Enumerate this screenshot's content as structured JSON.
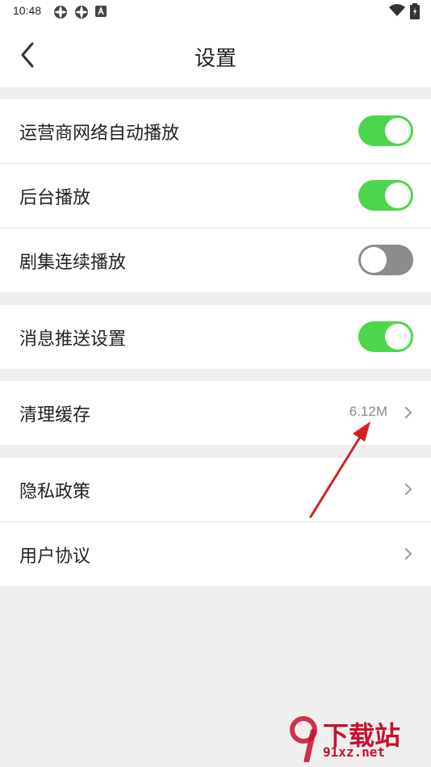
{
  "status_bar": {
    "time": "10:48",
    "icons": [
      "app-notification-icon",
      "app-notification-icon",
      "font-badge-icon",
      "wifi-icon",
      "battery-icon"
    ]
  },
  "header": {
    "title": "设置",
    "back_icon": "chevron-left-icon"
  },
  "groups": [
    {
      "items": [
        {
          "label": "运营商网络自动播放",
          "toggle": "on"
        },
        {
          "label": "后台播放",
          "toggle": "on"
        },
        {
          "label": "剧集连续播放",
          "toggle": "off"
        }
      ]
    },
    {
      "items": [
        {
          "label": "消息推送设置",
          "toggle": "on"
        }
      ]
    },
    {
      "items": [
        {
          "label": "清理缓存",
          "value": "6.12M",
          "chevron": true
        }
      ]
    },
    {
      "items": [
        {
          "label": "隐私政策",
          "chevron": true
        },
        {
          "label": "用户协议",
          "chevron": true
        }
      ]
    }
  ],
  "colors": {
    "toggle_on": "#4cd64c",
    "toggle_off": "#8c8c8c",
    "background": "#efefef",
    "annotation_arrow": "#d42020"
  },
  "watermark": {
    "text": "下载站",
    "url": "91xz.net"
  }
}
